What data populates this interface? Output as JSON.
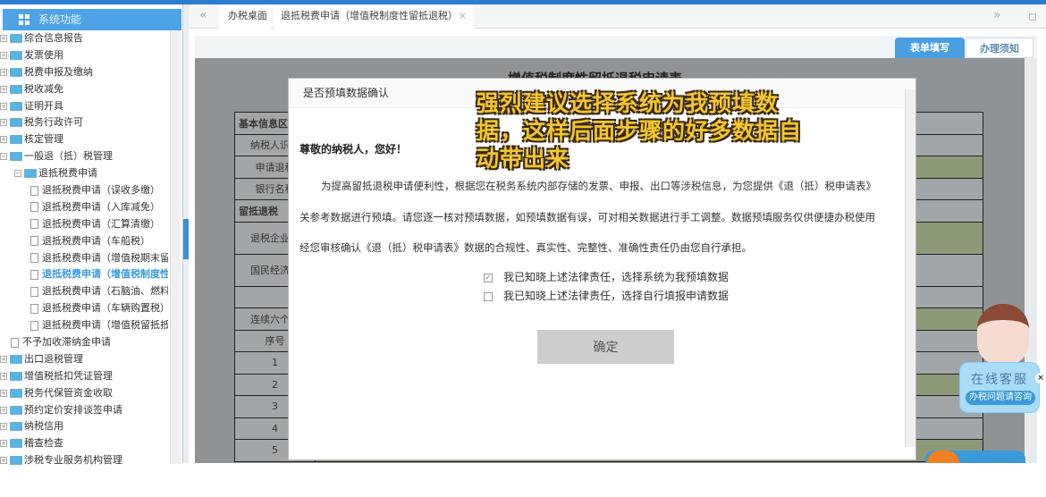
{
  "sidebar": {
    "title": "系统功能",
    "items": [
      {
        "label": "综合信息报告",
        "type": "folder",
        "level": 0,
        "expanded": false
      },
      {
        "label": "发票使用",
        "type": "folder",
        "level": 0,
        "expanded": false
      },
      {
        "label": "税费申报及缴纳",
        "type": "folder",
        "level": 0,
        "expanded": false
      },
      {
        "label": "税收减免",
        "type": "folder",
        "level": 0,
        "expanded": false
      },
      {
        "label": "证明开具",
        "type": "folder",
        "level": 0,
        "expanded": false
      },
      {
        "label": "税务行政许可",
        "type": "folder",
        "level": 0,
        "expanded": false
      },
      {
        "label": "核定管理",
        "type": "folder",
        "level": 0,
        "expanded": false
      },
      {
        "label": "一般退（抵）税管理",
        "type": "folder",
        "level": 0,
        "expanded": true
      },
      {
        "label": "退抵税费申请",
        "type": "folder",
        "level": 1,
        "expanded": true
      },
      {
        "label": "退抵税费申请（误收多缴）",
        "type": "doc",
        "level": 2
      },
      {
        "label": "退抵税费申请（入库减免）",
        "type": "doc",
        "level": 2
      },
      {
        "label": "退抵税费申请（汇算清缴）",
        "type": "doc",
        "level": 2
      },
      {
        "label": "退抵税费申请（车船税）",
        "type": "doc",
        "level": 2
      },
      {
        "label": "退抵税费申请（增值税期末留抵",
        "type": "doc",
        "level": 2
      },
      {
        "label": "退抵税费申请（增值税制度性留",
        "type": "doc",
        "level": 2,
        "selected": true
      },
      {
        "label": "退抵税费申请（石脑油、燃料油",
        "type": "doc",
        "level": 2
      },
      {
        "label": "退抵税费申请（车辆购置税）",
        "type": "doc",
        "level": 2
      },
      {
        "label": "退抵税费申请（增值税留抵抵欠",
        "type": "doc",
        "level": 2
      },
      {
        "label": "不予加收滞纳金申请",
        "type": "doc",
        "level": 1
      },
      {
        "label": "出口退税管理",
        "type": "folder",
        "level": 0,
        "expanded": false
      },
      {
        "label": "增值税抵扣凭证管理",
        "type": "folder",
        "level": 0,
        "expanded": false
      },
      {
        "label": "税务代保管资金收取",
        "type": "folder",
        "level": 0,
        "expanded": false
      },
      {
        "label": "预约定价安排谈签申请",
        "type": "folder",
        "level": 0,
        "expanded": false
      },
      {
        "label": "纳税信用",
        "type": "folder",
        "level": 0,
        "expanded": false
      },
      {
        "label": "稽查检查",
        "type": "folder",
        "level": 0,
        "expanded": false
      },
      {
        "label": "涉税专业服务机构管理",
        "type": "folder",
        "level": 0,
        "expanded": false
      }
    ]
  },
  "tabs": {
    "back": "«",
    "home": "办税桌面",
    "active": "退抵税费申请（增值税制度性留抵退税）",
    "close": "×",
    "forward": "»"
  },
  "right_tabs": {
    "form": "表单填写",
    "notice": "办理须知"
  },
  "form": {
    "title": "增值税制度性留抵退税申请表",
    "rows": [
      "基本信息区",
      "纳税人识别",
      "申请退税",
      "银行名称",
      "留抵退税",
      "退税企业类",
      "国民经济行",
      "",
      "连续六个月",
      "序号",
      "1",
      "2",
      "3",
      "4",
      "5"
    ]
  },
  "dialog": {
    "title": "是否预填数据确认",
    "greeting": "尊敬的纳税人，您好！",
    "paragraph_lines": [
      "为提高留抵退税申请便利性，根据您在税务系统内部存储的发票、申报、出口等涉税信息，为您提供《退（抵）税申请表》",
      "关参考数据进行预填。请您逐一核对预填数据，如预填数据有误，可对相关数据进行手工调整。数据预填服务仅供便捷办税使用",
      "经您审核确认《退（抵）税申请表》数据的合规性、真实性、完整性、准确性责任仍由您自行承担。"
    ],
    "options": [
      {
        "label": "我已知晓上述法律责任，选择系统为我预填数据",
        "checked": true
      },
      {
        "label": "我已知晓上述法律责任，选择自行填报申请数据",
        "checked": false
      }
    ],
    "confirm": "确定"
  },
  "caption": {
    "lines": [
      "强烈建议选择系统为我预填数",
      "据，这样后面步骤的好多数据自",
      "动带出来"
    ]
  },
  "customer_service": {
    "title": "在线客服",
    "subtitle": "办税问题请咨询",
    "close": "×"
  }
}
